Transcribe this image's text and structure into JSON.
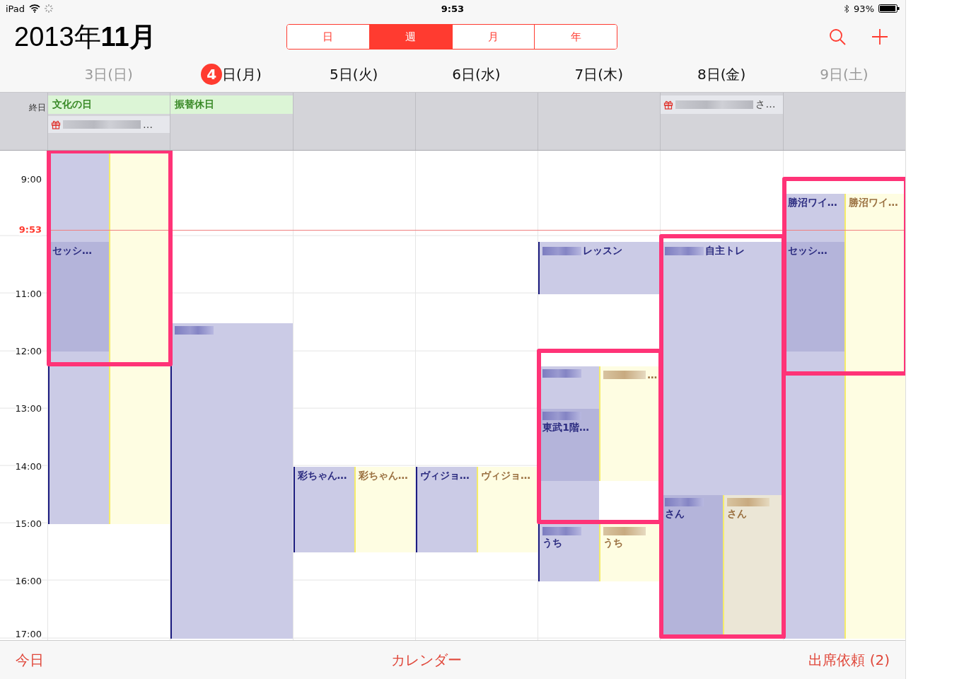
{
  "status_bar": {
    "device": "iPad",
    "time": "9:53",
    "battery": "93%"
  },
  "title": "2013年**11月**",
  "view_tabs": [
    {
      "label": "日",
      "selected": false
    },
    {
      "label": "週",
      "selected": true
    },
    {
      "label": "月",
      "selected": false
    },
    {
      "label": "年",
      "selected": false
    }
  ],
  "all_day_label": "終日",
  "days": [
    {
      "number": "3",
      "label": "日(日)",
      "weekend": true,
      "today": false,
      "highlighted": true,
      "all_day": [
        {
          "kind": "holiday",
          "title": "文化の日"
        },
        {
          "kind": "birthday",
          "title": "…"
        }
      ],
      "events": [
        {
          "kind": "purple",
          "redacted": false,
          "children": [
            {
              "kind": "purple-dark",
              "title": "セッシ…",
              "redacted": false
            }
          ]
        },
        {
          "kind": "yellow",
          "redacted": false
        }
      ]
    },
    {
      "number": "4",
      "label": "日(月)",
      "weekend": false,
      "today": true,
      "highlighted": false,
      "all_day": [
        {
          "kind": "holiday",
          "title": "振替休日"
        }
      ],
      "events": [
        {
          "kind": "purple",
          "redacted": true
        }
      ]
    },
    {
      "number": "5",
      "label": "日(火)",
      "weekend": false,
      "today": false,
      "highlighted": false,
      "events": [
        {
          "kind": "purple",
          "title": "彩ちゃん…",
          "redacted": false
        },
        {
          "kind": "yellow",
          "title": "彩ちゃん…",
          "redacted": false
        }
      ]
    },
    {
      "number": "6",
      "label": "日(水)",
      "weekend": false,
      "today": false,
      "highlighted": false,
      "events": [
        {
          "kind": "purple",
          "title": "ヴィジョ…",
          "redacted": false
        },
        {
          "kind": "yellow",
          "title": "ヴィジョ…",
          "redacted": false
        }
      ]
    },
    {
      "number": "7",
      "label": "日(木)",
      "weekend": false,
      "today": false,
      "highlighted": true,
      "events": [
        {
          "kind": "purple",
          "title": "レッスン",
          "redacted": true
        },
        {
          "kind": "purple",
          "redacted": true,
          "children": [
            {
              "kind": "purple-dark",
              "title": "東武1階…",
              "redacted": true
            }
          ]
        },
        {
          "kind": "yellow",
          "title": "…",
          "redacted": true
        },
        {
          "kind": "purple",
          "title": "うち",
          "redacted": true
        },
        {
          "kind": "yellow",
          "title": "うち",
          "redacted": true
        }
      ]
    },
    {
      "number": "8",
      "label": "日(金)",
      "weekend": false,
      "today": false,
      "highlighted": true,
      "all_day": [
        {
          "kind": "birthday",
          "title": "さ…"
        }
      ],
      "events": [
        {
          "kind": "purple",
          "title": "自主トレ",
          "redacted": true,
          "children": [
            {
              "kind": "purple-dark",
              "title": "さん",
              "redacted": true
            },
            {
              "kind": "beige",
              "title": "さん",
              "redacted": true
            }
          ]
        }
      ]
    },
    {
      "number": "9",
      "label": "日(土)",
      "weekend": true,
      "today": false,
      "highlighted": true,
      "events": [
        {
          "kind": "purple",
          "title": "勝沼ワイ…",
          "redacted": false,
          "children": [
            {
              "kind": "purple-dark",
              "title": "セッシ…",
              "redacted": false
            }
          ]
        },
        {
          "kind": "yellow",
          "title": "勝沼ワイ…",
          "redacted": false
        }
      ]
    }
  ],
  "hours": [
    "9:00",
    "11:00",
    "12:00",
    "13:00",
    "14:00",
    "15:00",
    "16:00",
    "17:00"
  ],
  "now": "9:53",
  "bottom_bar": {
    "today": "今日",
    "calendars": "カレンダー",
    "invitations": "出席依頼 (2)"
  }
}
